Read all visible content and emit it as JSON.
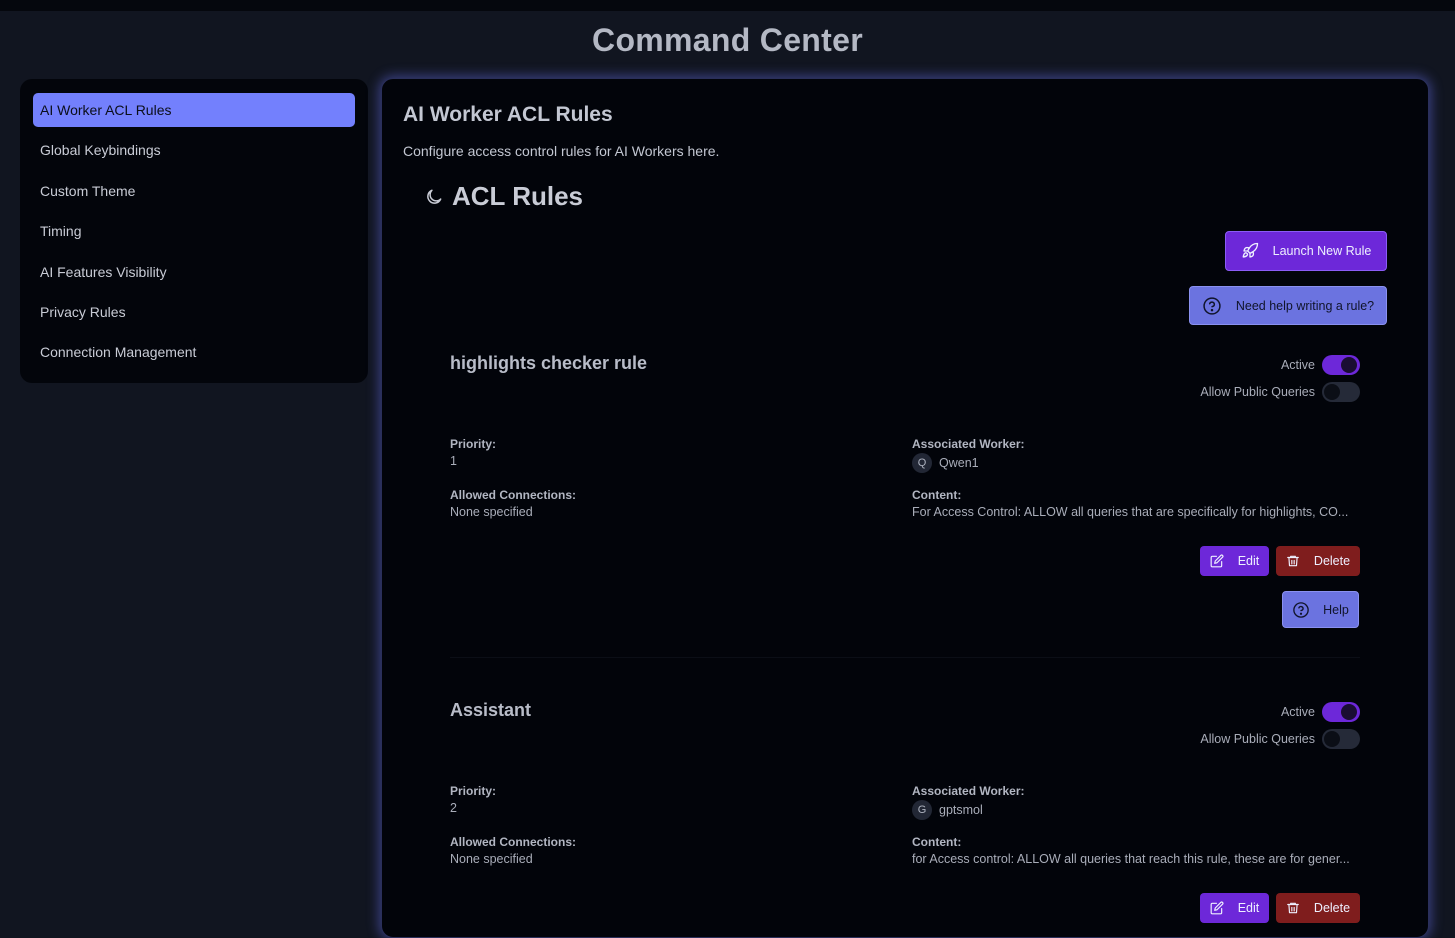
{
  "app": {
    "title": "Command Center"
  },
  "sidebar": {
    "items": [
      {
        "label": "AI Worker ACL Rules",
        "active": true
      },
      {
        "label": "Global Keybindings",
        "active": false
      },
      {
        "label": "Custom Theme",
        "active": false
      },
      {
        "label": "Timing",
        "active": false
      },
      {
        "label": "AI Features Visibility",
        "active": false
      },
      {
        "label": "Privacy Rules",
        "active": false
      },
      {
        "label": "Connection Management",
        "active": false
      }
    ]
  },
  "main": {
    "title": "AI Worker ACL Rules",
    "description": "Configure access control rules for AI Workers here.",
    "section_title": "ACL Rules",
    "section_icon": "moon-icon",
    "launch_button": "Launch New Rule",
    "need_help_button": "Need help writing a rule?"
  },
  "labels": {
    "active": "Active",
    "allow_public": "Allow Public Queries",
    "priority": "Priority:",
    "associated_worker": "Associated Worker:",
    "allowed_connections": "Allowed Connections:",
    "content": "Content:",
    "edit": "Edit",
    "delete": "Delete",
    "help": "Help"
  },
  "rules": [
    {
      "name": "highlights checker rule",
      "active": true,
      "allow_public_queries": false,
      "priority": "1",
      "worker_initial": "Q",
      "worker_name": "Qwen1",
      "allowed_connections": "None specified",
      "content": "For Access Control: ALLOW all queries that are specifically for highlights, CO..."
    },
    {
      "name": "Assistant",
      "active": true,
      "allow_public_queries": false,
      "priority": "2",
      "worker_initial": "G",
      "worker_name": "gptsmol",
      "allowed_connections": "None specified",
      "content": "for Access control: ALLOW all queries that reach this rule, these are for gener..."
    }
  ],
  "colors": {
    "accent": "#7380fd",
    "primary_button": "#6d28d9",
    "danger_button": "#7f1d1d",
    "background": "#111520",
    "panel": "#02040a"
  }
}
